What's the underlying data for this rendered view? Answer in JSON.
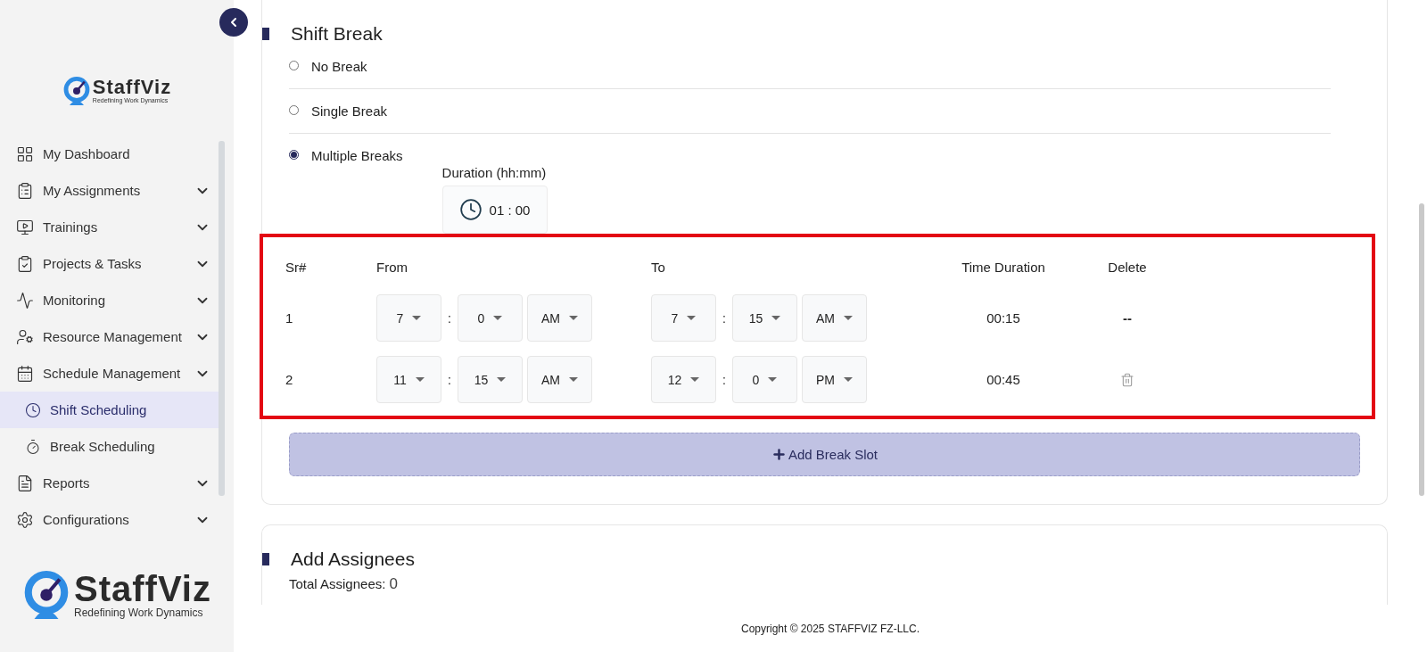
{
  "sidebar": {
    "logo": {
      "name": "StaffViz",
      "tagline": "Redefining Work Dynamics"
    },
    "items": [
      {
        "label": "My Dashboard",
        "kind": "item",
        "expandable": false,
        "selected": false
      },
      {
        "label": "My Assignments",
        "kind": "item",
        "expandable": true,
        "selected": false
      },
      {
        "label": "Trainings",
        "kind": "item",
        "expandable": true,
        "selected": false
      },
      {
        "label": "Projects & Tasks",
        "kind": "item",
        "expandable": true,
        "selected": false
      },
      {
        "label": "Monitoring",
        "kind": "item",
        "expandable": true,
        "selected": false
      },
      {
        "label": "Resource Management",
        "kind": "item",
        "expandable": true,
        "selected": false
      },
      {
        "label": "Schedule Management",
        "kind": "item",
        "expandable": true,
        "selected": false
      },
      {
        "label": "Shift Scheduling",
        "kind": "subitem",
        "expandable": false,
        "selected": true
      },
      {
        "label": "Break Scheduling",
        "kind": "subitem",
        "expandable": false,
        "selected": false
      },
      {
        "label": "Reports",
        "kind": "item",
        "expandable": true,
        "selected": false
      },
      {
        "label": "Configurations",
        "kind": "item",
        "expandable": true,
        "selected": false
      }
    ],
    "footer_logo": {
      "name": "StaffViz",
      "tagline": "Redefining Work Dynamics"
    }
  },
  "shift_break": {
    "title": "Shift Break",
    "options": [
      {
        "label": "No Break",
        "selected": false
      },
      {
        "label": "Single Break",
        "selected": false
      },
      {
        "label": "Multiple Breaks",
        "selected": true
      }
    ],
    "duration": {
      "label": "Duration (hh:mm)",
      "value": "01 : 00"
    },
    "table": {
      "columns": [
        "Sr#",
        "From",
        "To",
        "Time Duration",
        "Delete"
      ],
      "rows": [
        {
          "sr": "1",
          "from": {
            "hour": "7",
            "minute": "0",
            "period": "AM"
          },
          "to": {
            "hour": "7",
            "minute": "15",
            "period": "AM"
          },
          "duration": "00:15",
          "delete": {
            "kind": "dash",
            "text": "--"
          }
        },
        {
          "sr": "2",
          "from": {
            "hour": "11",
            "minute": "15",
            "period": "AM"
          },
          "to": {
            "hour": "12",
            "minute": "0",
            "period": "PM"
          },
          "duration": "00:45",
          "delete": {
            "kind": "trash"
          }
        }
      ],
      "separator": ":"
    },
    "add_button": "Add Break Slot"
  },
  "assignees": {
    "title": "Add Assignees",
    "total_label": "Total Assignees:",
    "total": "0"
  },
  "footer": {
    "copyright": "Copyright © 2025 STAFFVIZ FZ-LLC."
  }
}
